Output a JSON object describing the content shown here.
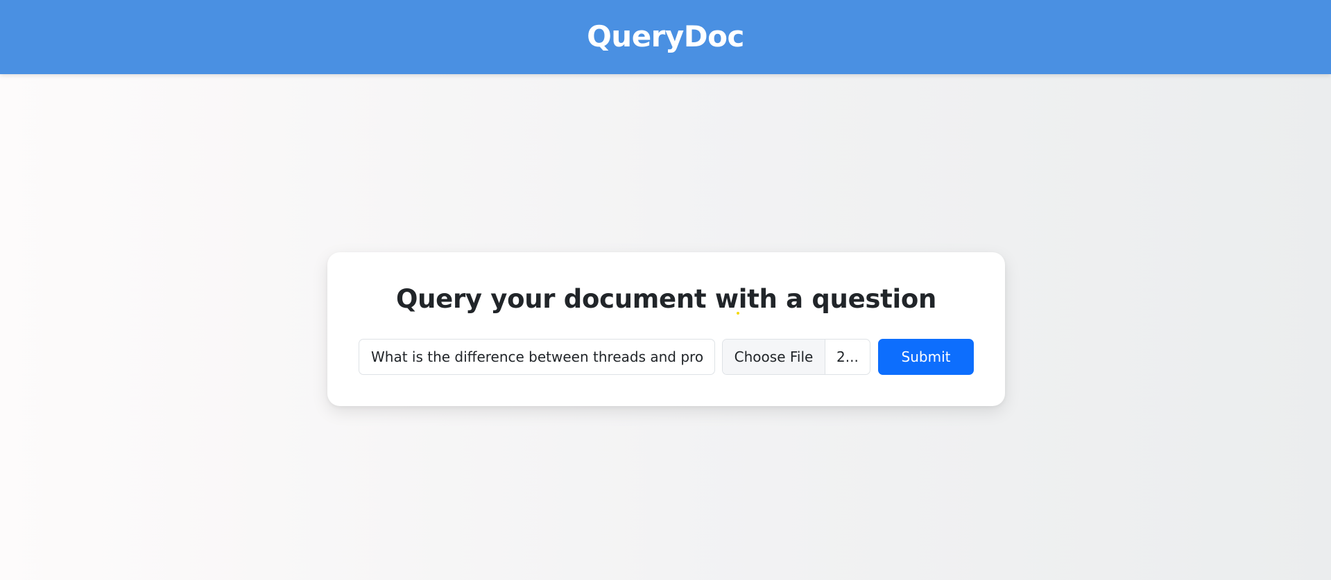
{
  "app": {
    "title": "QueryDoc"
  },
  "card": {
    "heading": "Query your document with a question"
  },
  "query": {
    "value": "What is the difference between threads and processes?",
    "placeholder": ""
  },
  "file": {
    "button_label": "Choose File",
    "selected_name": "2..."
  },
  "submit": {
    "label": "Submit"
  },
  "colors": {
    "header": "#4a90e2",
    "primary": "#0d6efd",
    "text": "#212529",
    "card": "#ffffff"
  }
}
